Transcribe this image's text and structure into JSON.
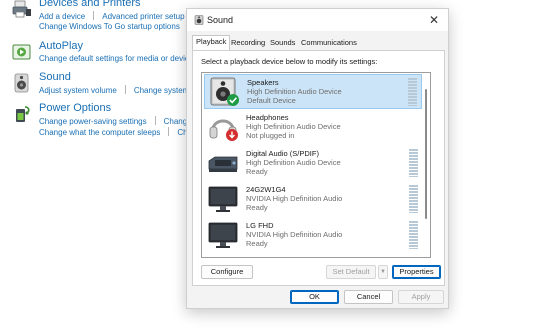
{
  "control_panel": {
    "sections": [
      {
        "title": "Devices and Printers",
        "icon": "printer-icon",
        "links": [
          "Add a device",
          "Advanced printer setup",
          "Change Windows To Go startup options"
        ]
      },
      {
        "title": "AutoPlay",
        "icon": "autoplay-icon",
        "links": [
          "Change default settings for media or devic"
        ]
      },
      {
        "title": "Sound",
        "icon": "speaker-icon",
        "links": [
          "Adjust system volume",
          "Change system"
        ]
      },
      {
        "title": "Power Options",
        "icon": "power-options-icon",
        "links": [
          "Change power-saving settings",
          "Change",
          "Change what the computer sleeps",
          "Ch"
        ]
      }
    ]
  },
  "dialog": {
    "title": "Sound",
    "close_glyph": "✕",
    "tabs": [
      "Playback",
      "Recording",
      "Sounds",
      "Communications"
    ],
    "active_tab": "Playback",
    "instruction": "Select a playback device below to modify its settings:",
    "devices": [
      {
        "name": "Speakers",
        "line1": "High Definition Audio Device",
        "line2": "Default Device",
        "icon": "speaker-device-icon",
        "badge": "default-check-icon",
        "selected": true
      },
      {
        "name": "Headphones",
        "line1": "High Definition Audio Device",
        "line2": "Not plugged in",
        "icon": "headphones-icon",
        "badge": "not-plugged-icon",
        "selected": false
      },
      {
        "name": "Digital Audio (S/PDIF)",
        "line1": "High Definition Audio Device",
        "line2": "Ready",
        "icon": "digital-audio-icon",
        "selected": false
      },
      {
        "name": "24G2W1G4",
        "line1": "NVIDIA High Definition Audio",
        "line2": "Ready",
        "icon": "monitor-icon",
        "selected": false
      },
      {
        "name": "LG FHD",
        "line1": "NVIDIA High Definition Audio",
        "line2": "Ready",
        "icon": "monitor-icon",
        "selected": false
      }
    ],
    "buttons": {
      "configure": "Configure",
      "set_default": "Set Default",
      "dropdown_glyph": "▼",
      "properties": "Properties",
      "ok": "OK",
      "cancel": "Cancel",
      "apply": "Apply"
    },
    "colors": {
      "accent": "#0067c0",
      "selection": "#cce4f7",
      "link": "#1a6fb4"
    }
  }
}
